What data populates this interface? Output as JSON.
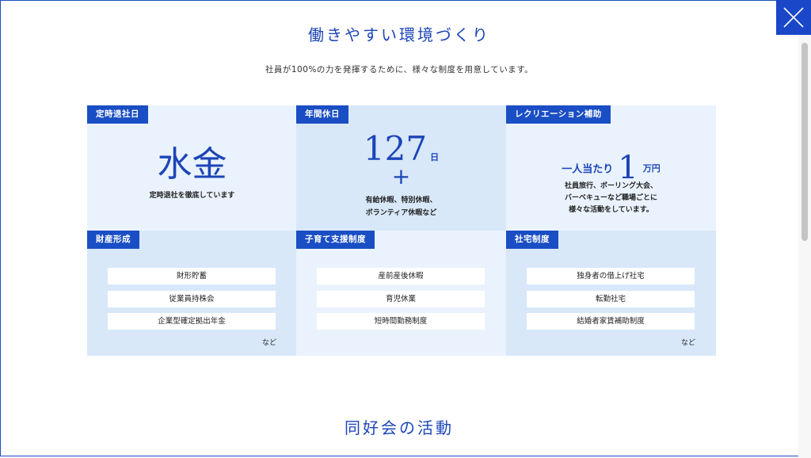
{
  "close_button": {
    "icon": "close-icon",
    "color": "#1947c8"
  },
  "section1": {
    "title": "働きやすい環境づくり",
    "subtitle": "社員が100%の力を発揮するために、様々な制度を用意しています。"
  },
  "cards": {
    "teiji": {
      "tag": "定時退社日",
      "big": "水金",
      "desc": "定時退社を徹底しています"
    },
    "kyujitsu": {
      "tag": "年間休日",
      "number": "127",
      "unit": "日",
      "plus": "+",
      "desc_line1": "有給休暇、特別休暇、",
      "desc_line2": "ボランティア休暇など"
    },
    "recreation": {
      "tag": "レクリエーション補助",
      "prefix": "一人当たり",
      "number": "1",
      "unit": "万円",
      "desc_line1": "社員旅行、ボーリング大会、",
      "desc_line2": "バーベキューなど職場ごとに",
      "desc_line3": "様々な活動をしています。"
    },
    "zaisan": {
      "tag": "財産形成",
      "items": [
        "財形貯蓄",
        "従業員持株会",
        "企業型確定拠出年金"
      ],
      "nado": "など"
    },
    "kosodate": {
      "tag": "子育て支援制度",
      "items": [
        "産前産後休暇",
        "育児休業",
        "短時間勤務制度"
      ]
    },
    "shataku": {
      "tag": "社宅制度",
      "items": [
        "独身者の借上げ社宅",
        "転勤社宅",
        "結婚者家賃補助制度"
      ],
      "nado": "など"
    }
  },
  "section2": {
    "title": "同好会の活動"
  },
  "colors": {
    "accent": "#1a4ec4",
    "card_light": "#eaf3fd",
    "card_mid": "#d8e8f9"
  }
}
